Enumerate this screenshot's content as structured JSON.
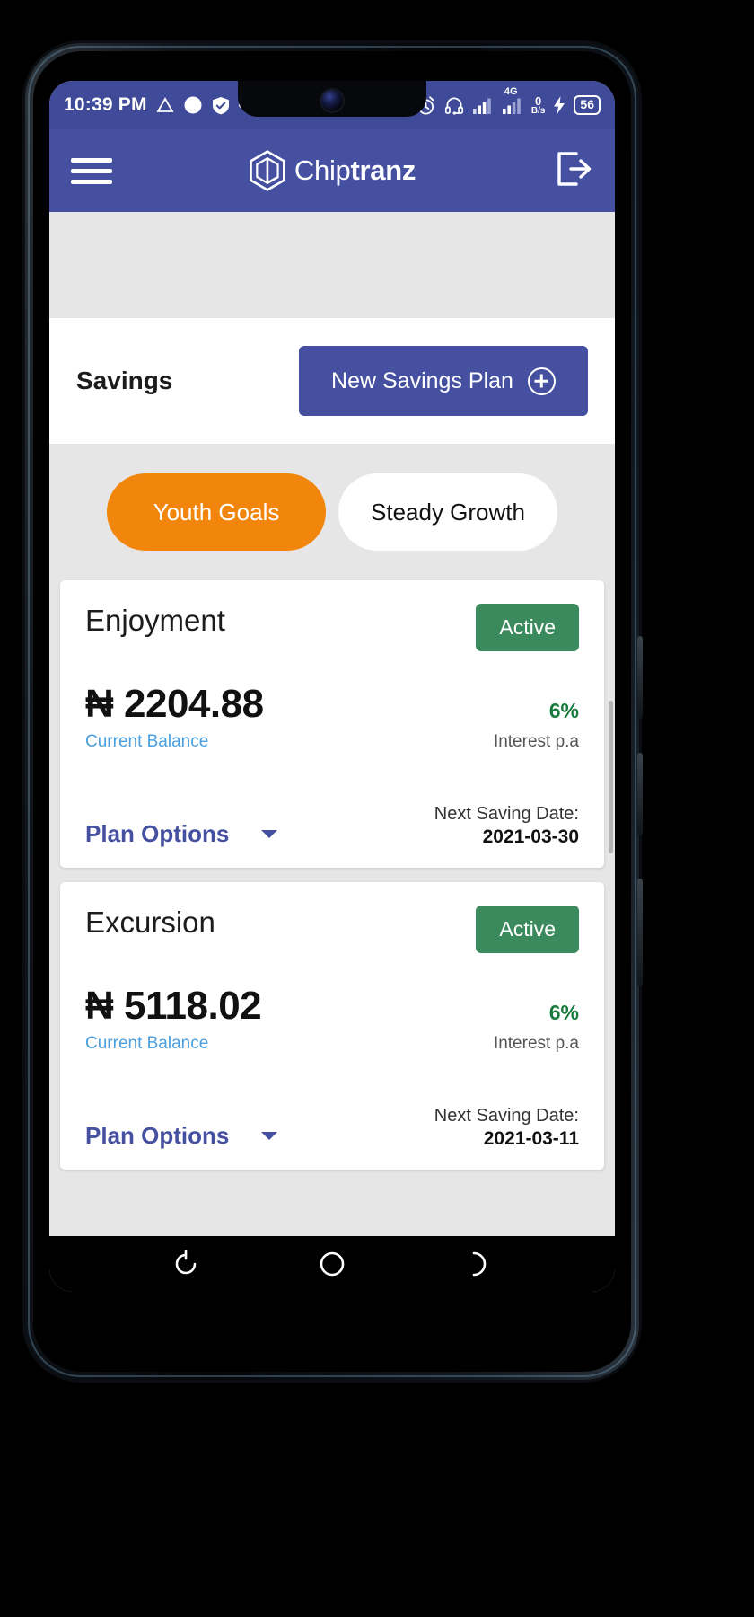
{
  "status_bar": {
    "time": "10:39 PM",
    "left_icons": [
      "triangle-outline-icon",
      "circle-filled-icon",
      "shield-check-icon",
      "more-dots-icon"
    ],
    "alarm_icon": "alarm-clock-icon",
    "headset_icon": "headset-icon",
    "network_type": "4G",
    "net_speed_value": "0",
    "net_speed_unit": "B/s",
    "charging_icon": "lightning-bolt-icon",
    "battery_level": "56"
  },
  "header": {
    "menu_icon": "hamburger-menu-icon",
    "brand_first": "Chip",
    "brand_second": "tranz",
    "logo_icon": "hexagon-chip-logo-icon",
    "logout_icon": "logout-arrow-icon"
  },
  "savings_section": {
    "title": "Savings",
    "new_plan_label": "New Savings Plan",
    "new_plan_icon": "plus-circle-icon"
  },
  "tabs": [
    {
      "label": "Youth Goals",
      "active": true
    },
    {
      "label": "Steady Growth",
      "active": false
    }
  ],
  "plans": [
    {
      "name": "Enjoyment",
      "status": "Active",
      "currency": "₦",
      "balance": "2204.88",
      "balance_label": "Current Balance",
      "interest": "6%",
      "interest_label": "Interest p.a",
      "options_label": "Plan Options",
      "next_label": "Next Saving Date:",
      "next_date": "2021-03-30"
    },
    {
      "name": "Excursion",
      "status": "Active",
      "currency": "₦",
      "balance": "5118.02",
      "balance_label": "Current Balance",
      "interest": "6%",
      "interest_label": "Interest p.a",
      "options_label": "Plan Options",
      "next_label": "Next Saving Date:",
      "next_date": "2021-03-11"
    }
  ],
  "nav_bar": {
    "back_icon": "back-circle-icon",
    "home_icon": "home-circle-icon",
    "recents_icon": "recents-icon"
  },
  "colors": {
    "header_purple": "#4650a0",
    "status_purple": "#3f4b99",
    "tab_orange": "#f2860d",
    "badge_green": "#3b8a5d",
    "link_blue": "#4a9fe0",
    "interest_green": "#1a7a3c",
    "page_gray": "#e6e6e6"
  }
}
